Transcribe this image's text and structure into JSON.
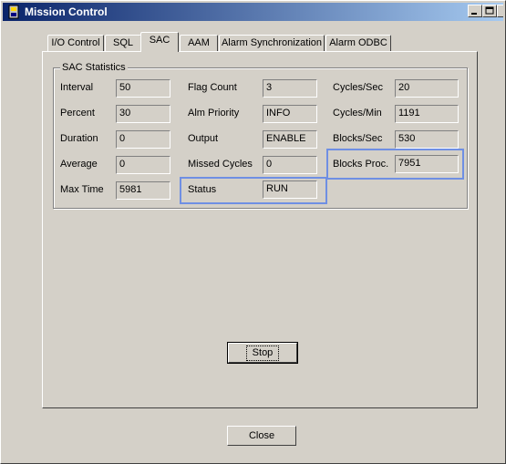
{
  "window": {
    "title": "Mission Control"
  },
  "tabs": [
    "I/O Control",
    "SQL",
    "SAC",
    "AAM",
    "Alarm Synchronization",
    "Alarm ODBC"
  ],
  "active_tab": "SAC",
  "group": {
    "title": "SAC Statistics"
  },
  "col1": [
    {
      "label": "Interval",
      "value": "50"
    },
    {
      "label": "Percent",
      "value": "30"
    },
    {
      "label": "Duration",
      "value": "0"
    },
    {
      "label": "Average",
      "value": "0"
    },
    {
      "label": "Max Time",
      "value": "5981"
    }
  ],
  "col2": [
    {
      "label": "Flag Count",
      "value": "3"
    },
    {
      "label": "Alm Priority",
      "value": "INFO"
    },
    {
      "label": "Output",
      "value": "ENABLE"
    },
    {
      "label": "Missed Cycles",
      "value": "0"
    },
    {
      "label": "Status",
      "value": "RUN"
    }
  ],
  "col3": [
    {
      "label": "Cycles/Sec",
      "value": "20"
    },
    {
      "label": "Cycles/Min",
      "value": "1191"
    },
    {
      "label": "Blocks/Sec",
      "value": "530"
    },
    {
      "label": "Blocks Proc.",
      "value": "7951"
    }
  ],
  "buttons": {
    "stop": "Stop",
    "close": "Close"
  },
  "colors": {
    "highlight": "#6f8fe3",
    "titlebar_start": "#0a246a",
    "titlebar_end": "#a6caf0"
  }
}
